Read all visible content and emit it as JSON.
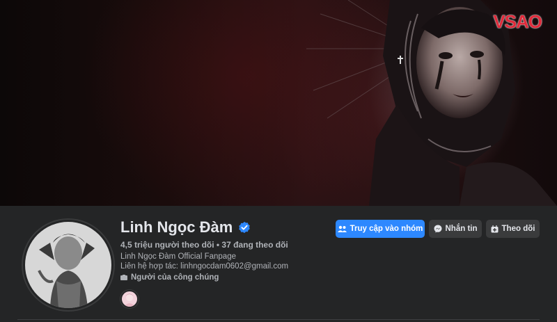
{
  "brand": {
    "logo_text": "VSAO",
    "color": "#e02a3a"
  },
  "profile": {
    "name": "Linh Ngọc Đàm",
    "verified_icon": "verified-badge-icon",
    "stats": "4,5 triệu người theo dõi • 37 đang theo dõi",
    "subtitle": "Linh Ngọc Đàm Official Fanpage",
    "contact": "Liên hệ hợp tác: linhngocdam0602@gmail.com",
    "category": "Người của công chúng"
  },
  "actions": {
    "visit_group": "Truy cập vào nhóm",
    "message": "Nhắn tin",
    "follow": "Theo dõi"
  },
  "colors": {
    "primary": "#2d88ff",
    "background": "#242526",
    "button": "#3a3b3c",
    "verified": "#2d88ff"
  }
}
